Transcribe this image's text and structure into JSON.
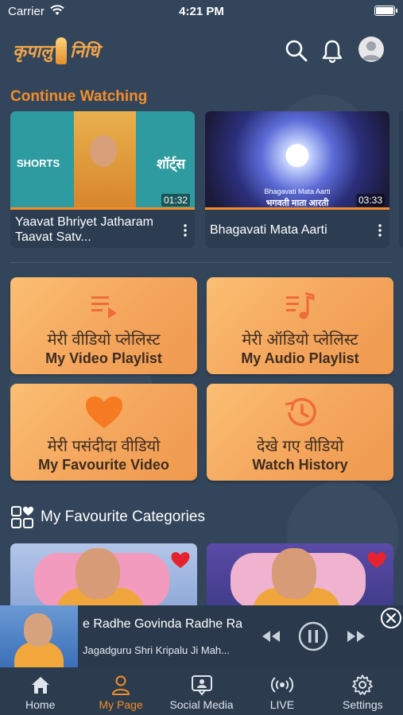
{
  "status_bar": {
    "carrier": "Carrier",
    "time": "4:21 PM"
  },
  "header": {
    "logo_text_left": "कृपालु",
    "logo_text_right": "निधि"
  },
  "continue_watching": {
    "title": "Continue Watching",
    "items": [
      {
        "title": "Yaavat Bhriyet Jatharam Taavat Satv...",
        "duration": "01:32",
        "progress": 1.0,
        "thumb_label": "SHORTS",
        "thumb_label_hi": "शॉर्ट्स"
      },
      {
        "title": "Bhagavati Mata Aarti",
        "duration": "03:33",
        "progress": 1.0,
        "caption_en": "Bhagavati Mata Aarti",
        "caption_hi": "भगवती माता आरती"
      }
    ]
  },
  "tiles": [
    {
      "hindi": "मेरी वीडियो प्लेलिस्ट",
      "english": "My Video Playlist",
      "icon": "video-playlist-icon"
    },
    {
      "hindi": "मेरी ऑडियो प्लेलिस्ट",
      "english": "My Audio Playlist",
      "icon": "audio-playlist-icon"
    },
    {
      "hindi": "मेरी पसंदीदा वीडियो",
      "english": "My Favourite Video",
      "icon": "heart-icon"
    },
    {
      "hindi": "देखे गए वीडियो",
      "english": "Watch History",
      "icon": "history-icon"
    }
  ],
  "favourite_categories": {
    "title": "My Favourite Categories"
  },
  "mini_player": {
    "title": "e Radhe Govinda Radhe Ra",
    "subtitle": "Jagadguru Shri Kripalu Ji Mah..."
  },
  "tab_bar": {
    "items": [
      {
        "label": "Home",
        "icon": "home-icon",
        "active": false
      },
      {
        "label": "My Page",
        "icon": "person-icon",
        "active": true
      },
      {
        "label": "Social Media",
        "icon": "social-icon",
        "active": false
      },
      {
        "label": "LIVE",
        "icon": "live-icon",
        "active": false
      },
      {
        "label": "Settings",
        "icon": "settings-icon",
        "active": false
      }
    ]
  },
  "colors": {
    "accent": "#f38d2a",
    "background": "#33455a",
    "tile": "#f4a55c",
    "tile_text": "#3d2c20",
    "heart": "#e5232e"
  }
}
